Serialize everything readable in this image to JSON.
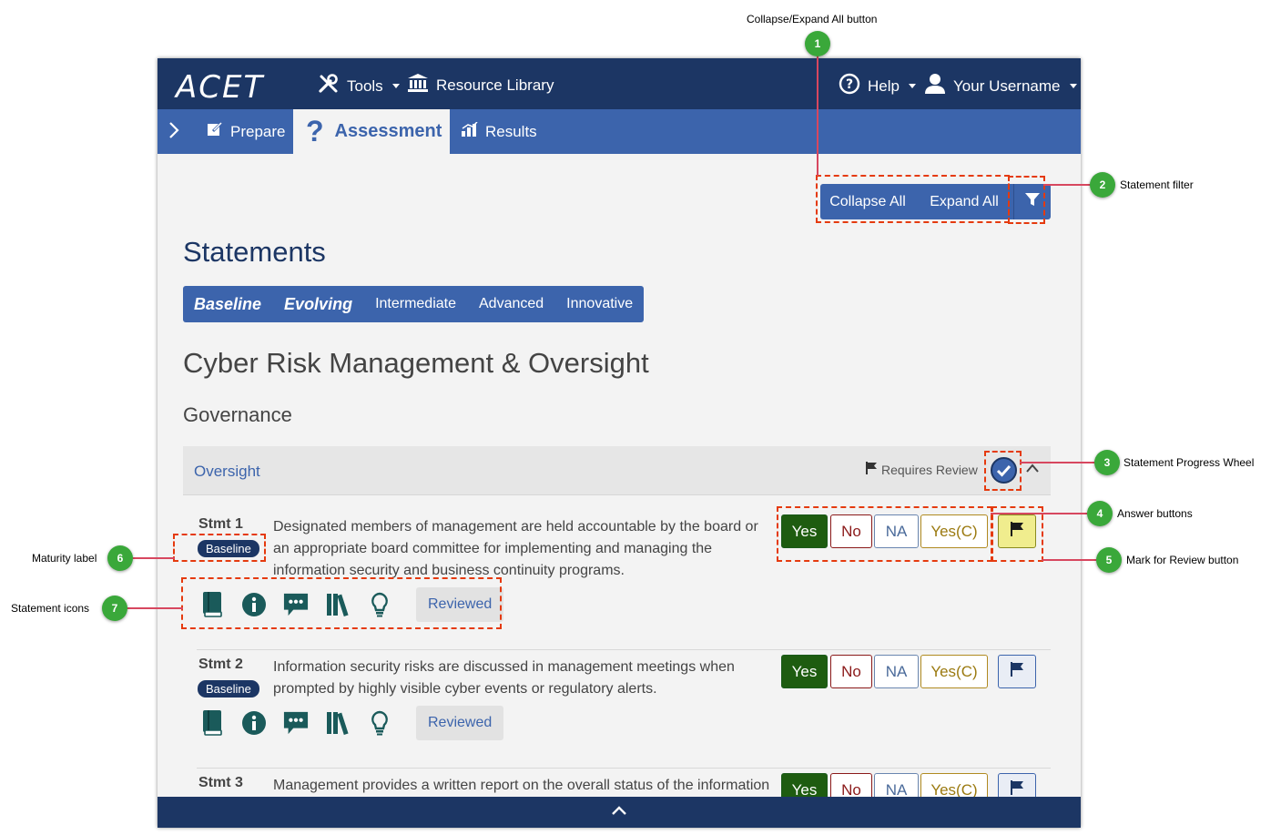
{
  "nav": {
    "logo": "ACET",
    "tools": "Tools",
    "resource_library": "Resource Library",
    "help": "Help",
    "username": "Your Username"
  },
  "subnav": {
    "prepare": "Prepare",
    "assessment": "Assessment",
    "results": "Results"
  },
  "toolbar": {
    "collapse_all": "Collapse All",
    "expand_all": "Expand All"
  },
  "page": {
    "title": "Statements",
    "maturity_levels": [
      "Baseline",
      "Evolving",
      "Intermediate",
      "Advanced",
      "Innovative"
    ],
    "domain": "Cyber Risk Management & Oversight",
    "component": "Governance"
  },
  "group": {
    "title": "Oversight",
    "requires_review": "Requires Review"
  },
  "answers": {
    "yes": "Yes",
    "no": "No",
    "na": "NA",
    "yesc": "Yes(C)"
  },
  "reviewed_label": "Reviewed",
  "statements": [
    {
      "num": "Stmt 1",
      "maturity": "Baseline",
      "text": "Designated members of management are held accountable by the board or an appropriate board committee for implementing and managing the information security and business continuity programs.",
      "marked_for_review": true
    },
    {
      "num": "Stmt 2",
      "maturity": "Baseline",
      "text": "Information security risks are discussed in management meetings when prompted by highly visible cyber events or regulatory alerts.",
      "marked_for_review": false
    },
    {
      "num": "Stmt 3",
      "maturity": "",
      "text": "Management provides a written report on the overall status of the information",
      "marked_for_review": false
    }
  ],
  "icons": [
    "book-icon",
    "info-icon",
    "comment-icon",
    "library-icon",
    "lightbulb-icon"
  ],
  "callouts": [
    {
      "number": "1",
      "label": "Collapse/Expand All button"
    },
    {
      "number": "2",
      "label": "Statement filter"
    },
    {
      "number": "3",
      "label": "Statement Progress Wheel"
    },
    {
      "number": "4",
      "label": "Answer buttons"
    },
    {
      "number": "5",
      "label": "Mark for Review button"
    },
    {
      "number": "6",
      "label": "Maturity label"
    },
    {
      "number": "7",
      "label": "Statement icons"
    }
  ],
  "colors": {
    "nav_dark": "#1c3664",
    "nav_blue": "#3c64ac",
    "yes_green": "#1e5c10",
    "no_red": "#8b1a1a",
    "review_yellow": "#f0ed8e",
    "callout_green": "#3aa83a",
    "callout_dash": "#e53a0e"
  }
}
